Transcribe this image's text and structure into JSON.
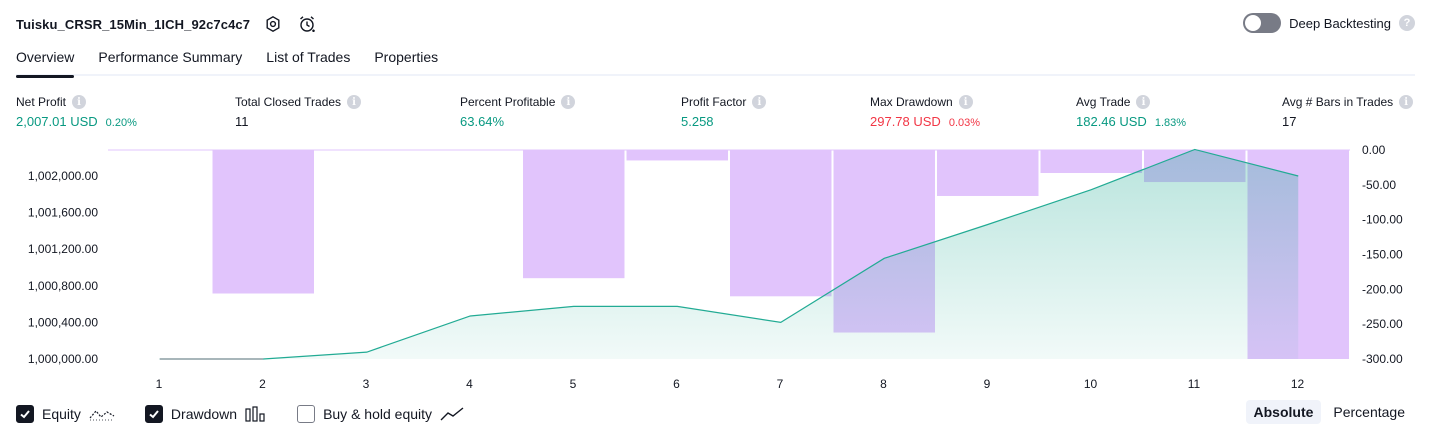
{
  "header": {
    "strategy_name": "Tuisku_CRSR_15Min_1ICH_92c7c4c7",
    "deep_backtesting_label": "Deep Backtesting",
    "help_glyph": "?"
  },
  "tabs": [
    {
      "label": "Overview",
      "active": true
    },
    {
      "label": "Performance Summary",
      "active": false
    },
    {
      "label": "List of Trades",
      "active": false
    },
    {
      "label": "Properties",
      "active": false
    }
  ],
  "metrics": {
    "info_glyph": "i",
    "net_profit": {
      "label": "Net Profit",
      "value": "2,007.01 USD",
      "pct": "0.20%"
    },
    "total_closed_trades": {
      "label": "Total Closed Trades",
      "value": "11"
    },
    "percent_profitable": {
      "label": "Percent Profitable",
      "value": "63.64%"
    },
    "profit_factor": {
      "label": "Profit Factor",
      "value": "5.258"
    },
    "max_drawdown": {
      "label": "Max Drawdown",
      "value": "297.78 USD",
      "pct": "0.03%"
    },
    "avg_trade": {
      "label": "Avg Trade",
      "value": "182.46 USD",
      "pct": "1.83%"
    },
    "avg_bars": {
      "label": "Avg # Bars in Trades",
      "value": "17"
    }
  },
  "colors": {
    "positive": "#089981",
    "negative": "#f23645",
    "equity_line": "#22ab94",
    "equity_fill": "#b2e5d8",
    "drawdown_bar": "#e1c4fc"
  },
  "chart_data": {
    "type": "area",
    "x": [
      1,
      2,
      3,
      4,
      5,
      6,
      7,
      8,
      9,
      10,
      11,
      12
    ],
    "x_tick_labels": [
      "1",
      "2",
      "3",
      "4",
      "5",
      "6",
      "7",
      "8",
      "9",
      "10",
      "11",
      "12"
    ],
    "left_axis": {
      "ticks": [
        1000000,
        1000400,
        1000800,
        1001200,
        1001600,
        1002000
      ],
      "tick_labels": [
        "1,000,000.00",
        "1,000,400.00",
        "1,000,800.00",
        "1,001,200.00",
        "1,001,600.00",
        "1,002,000.00"
      ],
      "range": [
        1000000,
        1002290
      ]
    },
    "right_axis": {
      "ticks": [
        0,
        -50,
        -100,
        -150,
        -200,
        -250,
        -300
      ],
      "tick_labels": [
        "0.00",
        "-50.00",
        "-100.00",
        "-150.00",
        "-200.00",
        "-250.00",
        "-300.00"
      ],
      "range": [
        -300,
        0
      ]
    },
    "series": [
      {
        "name": "Equity",
        "type": "area",
        "axis": "left",
        "values": [
          1000000,
          1000000,
          1000075,
          1000470,
          1000575,
          1000575,
          1000400,
          1001100,
          1001470,
          1001850,
          1002290,
          1002000
        ]
      },
      {
        "name": "Drawdown",
        "type": "bar",
        "axis": "right",
        "values": [
          0,
          -206,
          0,
          0,
          -184,
          -15,
          -210,
          -262,
          -66,
          -33,
          -46,
          -300
        ]
      }
    ],
    "grid": false
  },
  "legend": {
    "equity": {
      "label": "Equity",
      "checked": true
    },
    "drawdown": {
      "label": "Drawdown",
      "checked": true
    },
    "buy_hold": {
      "label": "Buy & hold equity",
      "checked": false
    }
  },
  "view_mode": {
    "absolute": "Absolute",
    "percentage": "Percentage",
    "selected": "absolute"
  }
}
